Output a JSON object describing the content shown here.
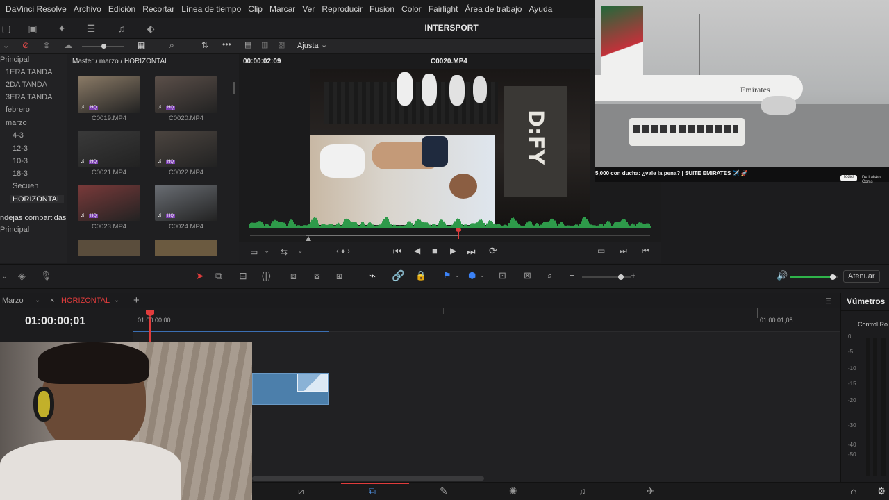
{
  "menubar": {
    "items": [
      "DaVinci Resolve",
      "Archivo",
      "Edición",
      "Recortar",
      "Línea de tiempo",
      "Clip",
      "Marcar",
      "Ver",
      "Reproducir",
      "Fusion",
      "Color",
      "Fairlight",
      "Área de trabajo",
      "Ayuda"
    ]
  },
  "project": {
    "title": "INTERSPORT"
  },
  "media_pool": {
    "path": "Master / marzo / HORIZONTAL",
    "bins": [
      "Principal",
      "1ERA TANDA",
      "2DA TANDA",
      "3ERA TANDA",
      "febrero",
      "marzo",
      "4-3",
      "12-3",
      "10-3",
      "18-3",
      "Secuen",
      "HORIZONTAL"
    ],
    "shared_label": "ndejas compartidas",
    "shared_item": "Principal",
    "clips": [
      {
        "name": "C0019.MP4",
        "color": "#8a7a66"
      },
      {
        "name": "C0020.MP4",
        "color": "#5b4f49"
      },
      {
        "name": "C0021.MP4",
        "color": "#3a3a3a"
      },
      {
        "name": "C0022.MP4",
        "color": "#4c4540"
      },
      {
        "name": "C0023.MP4",
        "color": "#7a3a3a"
      },
      {
        "name": "C0024.MP4",
        "color": "#6a6e74"
      }
    ],
    "clip_badge": "HQ"
  },
  "viewer": {
    "timecode": "00:00:02:09",
    "clip_name": "C0020.MP4",
    "zoom": "Ajusta",
    "sign_text": "D:FY",
    "playhead_position": 0.52
  },
  "web_panel": {
    "video_title": "5,000 con ducha: ¿vale la pena? | SUITE EMIRATES ✈️ 🚀",
    "chip_label": "Todos",
    "right_label": "De Laisko Coms",
    "airline_text": "Emirates"
  },
  "timeline": {
    "tab_left": "Marzo",
    "tab_active": "HORIZONTAL",
    "add_label": "+",
    "current_timecode": "01:00:00;01",
    "ruler_start": "01:00:00;00",
    "ruler_end": "01:00:01;08",
    "mute_label": "Atenuar",
    "volume_level": 0.9
  },
  "meters": {
    "title": "Vúmetros",
    "subtitle": "Control Ro",
    "scale": [
      "0",
      "-5",
      "-10",
      "-15",
      "-20",
      "-30",
      "-40",
      "-50"
    ]
  },
  "colors": {
    "accent_red": "#e03c3c",
    "clip_blue": "#4c7fab",
    "waveform_green": "#2e9a4a"
  }
}
